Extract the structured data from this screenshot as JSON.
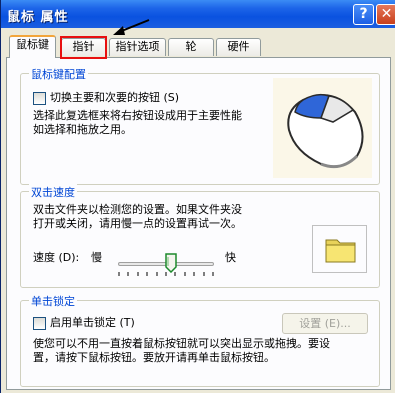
{
  "window": {
    "title": "鼠标 属性",
    "help_glyph": "?",
    "close_glyph": "✕"
  },
  "tabs": [
    {
      "label": "鼠标键",
      "active": true
    },
    {
      "label": "指针",
      "active": false,
      "highlighted": true
    },
    {
      "label": "指针选项",
      "active": false
    },
    {
      "label": "轮",
      "active": false
    },
    {
      "label": "硬件",
      "active": false
    }
  ],
  "button_config": {
    "legend": "鼠标键配置",
    "switch_label": "切换主要和次要的按钮 (S)",
    "switch_checked": false,
    "desc_line1": "选择此复选框来将右按钮设成用于主要性能",
    "desc_line2": "如选择和拖放之用。",
    "mouse_icon": "mouse-right-primary-icon"
  },
  "double_click": {
    "legend": "双击速度",
    "desc_line1": "双击文件夹以检测您的设置。如果文件夹没",
    "desc_line2": "打开或关闭，请用慢一点的设置再试一次。",
    "speed_label": "速度 (D):",
    "slow_label": "慢",
    "fast_label": "快",
    "speed_level": 0.55,
    "folder_icon": "folder-icon"
  },
  "click_lock": {
    "legend": "单击锁定",
    "enable_label": "启用单击锁定 (T)",
    "enable_checked": false,
    "settings_button": "设置 (E)...",
    "desc_line1": "使您可以不用一直按着鼠标按钮就可以突出显示或拖拽。要设",
    "desc_line2": "置，请按下鼠标按钮。要放开请再单击鼠标按钮。"
  },
  "colors": {
    "title_bar": "#0a52e0",
    "legend_text": "#0046d5",
    "highlight_box": "#e81010",
    "active_tab_accent": "#f2a53a"
  }
}
